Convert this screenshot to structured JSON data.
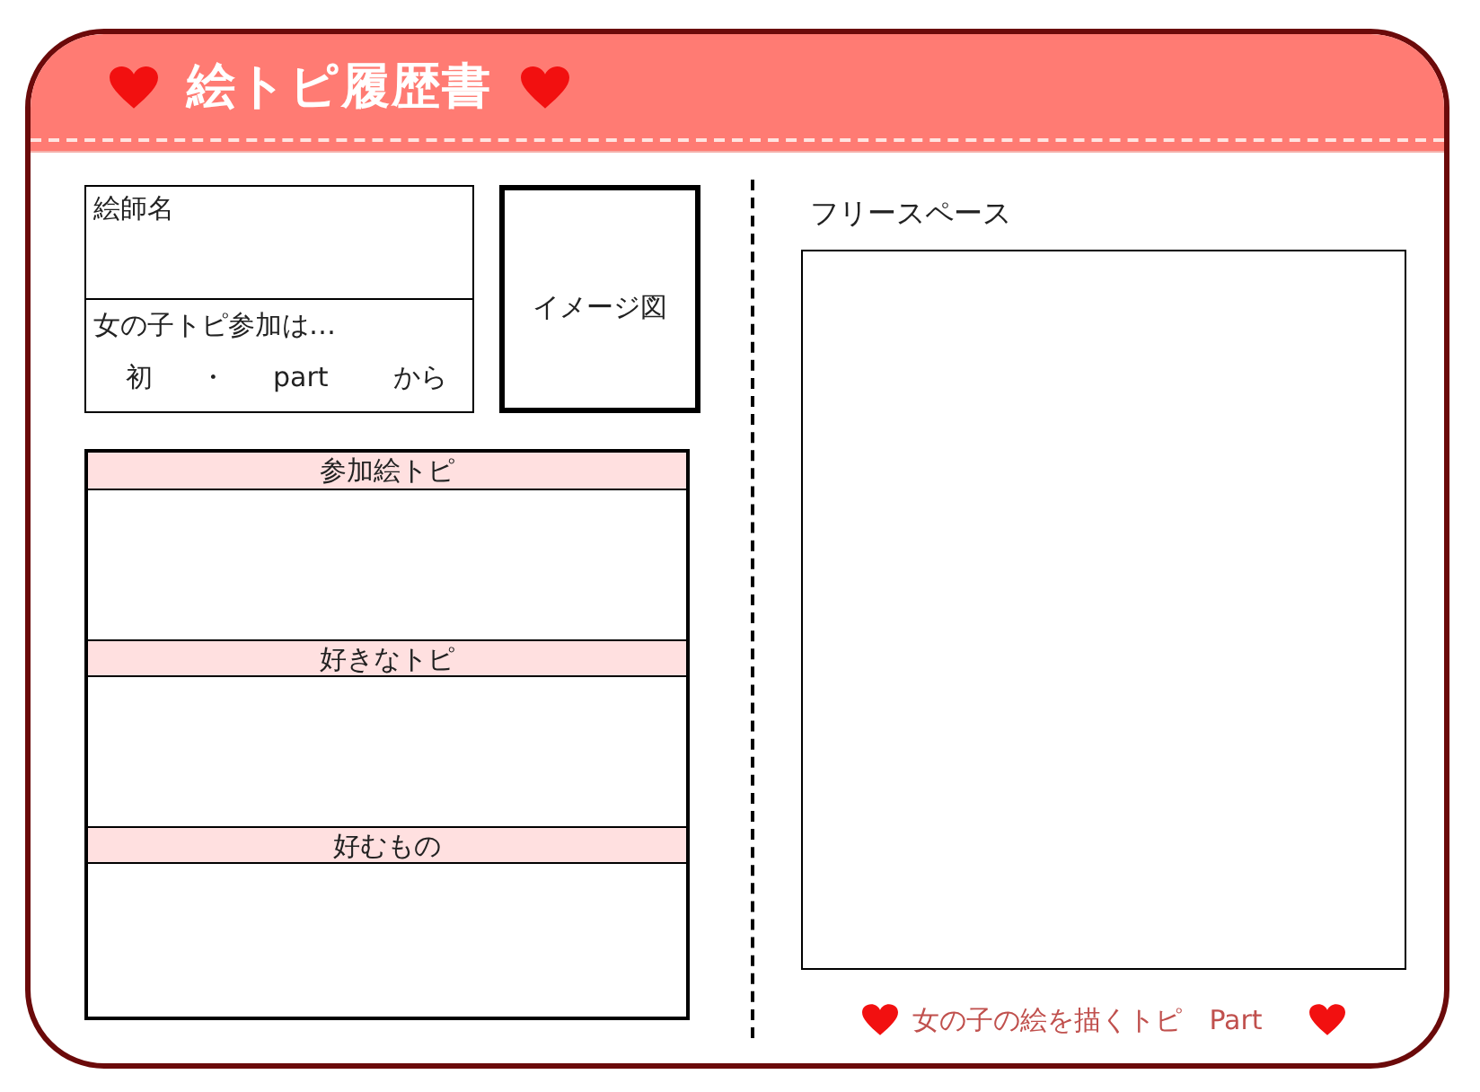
{
  "header": {
    "title": "絵トピ履歴書"
  },
  "profile": {
    "name_label": "絵師名",
    "participation_label": "女の子トピ参加は…",
    "participation_options": [
      "初",
      "・",
      "part",
      "から"
    ]
  },
  "image_box": {
    "label": "イメージ図"
  },
  "sections": [
    {
      "title": "参加絵トピ"
    },
    {
      "title": "好きなトピ"
    },
    {
      "title": "好むもの"
    }
  ],
  "free_space": {
    "label": "フリースペース"
  },
  "footer": {
    "text": "女の子の絵を描くトピ　Part"
  }
}
